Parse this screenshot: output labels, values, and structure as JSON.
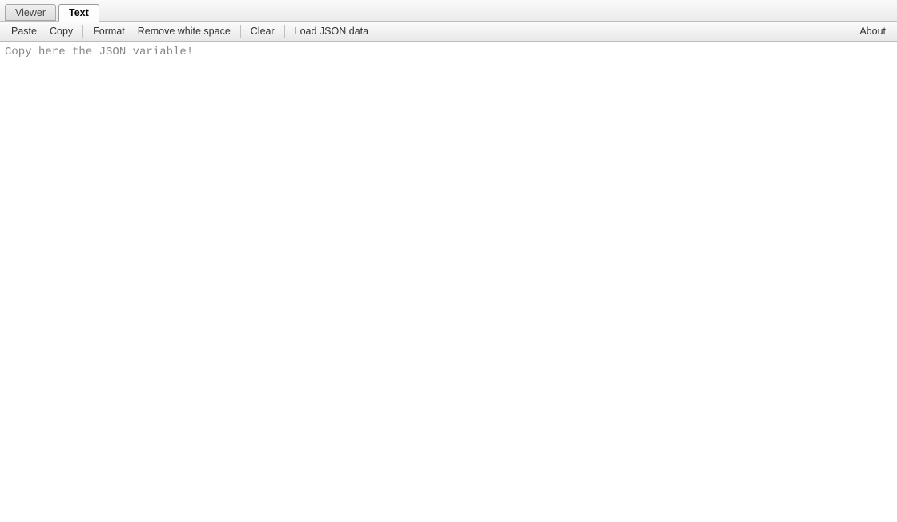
{
  "tabs": {
    "viewer": "Viewer",
    "text": "Text"
  },
  "toolbar": {
    "paste": "Paste",
    "copy": "Copy",
    "format": "Format",
    "remove_ws": "Remove white space",
    "clear": "Clear",
    "load_json": "Load JSON data",
    "about": "About"
  },
  "editor": {
    "placeholder": "Copy here the JSON variable!",
    "value": ""
  }
}
